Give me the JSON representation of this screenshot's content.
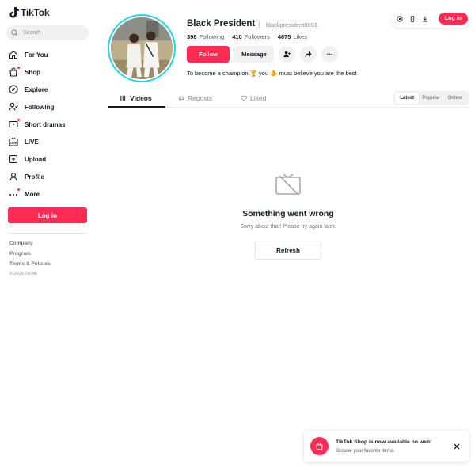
{
  "app": {
    "logo_text": "TikTok",
    "accent": "#fe2c55",
    "avatar_ring": "#20d5ec"
  },
  "sidebar": {
    "search_placeholder": "Search",
    "items": [
      {
        "label": "For You",
        "icon": "home-icon",
        "dot": false
      },
      {
        "label": "Shop",
        "icon": "shopping-bag-icon",
        "dot": true
      },
      {
        "label": "Explore",
        "icon": "compass-icon",
        "dot": false
      },
      {
        "label": "Following",
        "icon": "following-icon",
        "dot": false
      },
      {
        "label": "Short dramas",
        "icon": "short-dramas-icon",
        "dot": true
      },
      {
        "label": "LIVE",
        "icon": "live-icon",
        "dot": false
      },
      {
        "label": "Upload",
        "icon": "upload-icon",
        "dot": false
      },
      {
        "label": "Profile",
        "icon": "profile-icon",
        "dot": false
      },
      {
        "label": "More",
        "icon": "more-icon",
        "dot": true
      }
    ],
    "login_label": "Log in",
    "footer": {
      "company": "Company",
      "program": "Program",
      "terms": "Terms & Policies",
      "copyright": "© 2026 TikTok"
    }
  },
  "topbar": {
    "login_label": "Log in",
    "icons": [
      "compass-icon",
      "phone-icon",
      "download-icon"
    ]
  },
  "profile": {
    "name": "Black President",
    "handle": "blackpresident0001",
    "following_count": "398",
    "following_label": "Following",
    "followers_count": "410",
    "followers_label": "Followers",
    "likes_count": "4675",
    "likes_label": "Likes",
    "follow_label": "Follow",
    "message_label": "Message",
    "bio": "To become a champion 🏆 you 🫵 must believe you are the best"
  },
  "tabs": {
    "videos": "Videos",
    "reposts": "Reposts",
    "liked": "Liked"
  },
  "sort": {
    "latest": "Latest",
    "popular": "Popular",
    "oldest": "Oldest"
  },
  "error": {
    "title": "Something went wrong",
    "subtitle": "Sorry about that! Please try again later.",
    "refresh_label": "Refresh"
  },
  "toast": {
    "title": "TikTok Shop is now available on web!",
    "subtitle": "Browse your favorite items."
  }
}
